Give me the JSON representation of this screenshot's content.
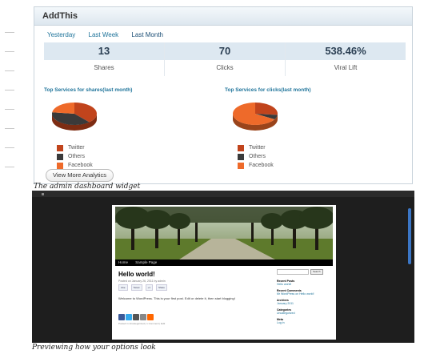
{
  "widget": {
    "title": "AddThis",
    "tabs": [
      "Yesterday",
      "Last Week",
      "Last Month"
    ],
    "stats": [
      {
        "value": "13",
        "label": "Shares"
      },
      {
        "value": "70",
        "label": "Clicks"
      },
      {
        "value": "538.46%",
        "label": "Viral Lift"
      }
    ],
    "shares_panel": {
      "title": "Top Services for shares(last month)",
      "legend": [
        "Twitter",
        "Others",
        "Facebook"
      ],
      "chart_data": {
        "type": "pie",
        "labels": [
          "Twitter",
          "Others",
          "Facebook"
        ],
        "values": [
          5,
          5,
          3
        ]
      }
    },
    "clicks_panel": {
      "title": "Top Services for clicks(last month)",
      "legend": [
        "Twitter",
        "Others",
        "Facebook"
      ],
      "chart_data": {
        "type": "pie",
        "labels": [
          "Twitter",
          "Others",
          "Facebook"
        ],
        "values": [
          4,
          1,
          10
        ]
      }
    },
    "colors": {
      "twitter": "#c1441c",
      "others": "#3a3a3a",
      "facebook": "#ee6a2a"
    },
    "button": "View More Analytics"
  },
  "caption1": "The admin dashboard widget",
  "preview": {
    "nav": [
      "Home",
      "Sample Page"
    ],
    "post_title": "Hello world!",
    "meta": "Posted on January 26, 2011 by admin",
    "share_buttons": [
      "Like",
      "Tweet",
      "+1",
      "Share"
    ],
    "body": "Welcome to WordPress. This is your first post. Edit or delete it, then start blogging!",
    "footer": "Posted in Uncategorized | 1 Comment | Edit",
    "search_button": "Search",
    "sidebar": [
      {
        "heading": "Recent Posts",
        "item": "Hello world!"
      },
      {
        "heading": "Recent Comments",
        "item": "Mr WordPress on Hello world!"
      },
      {
        "heading": "Archives",
        "item": "January 2011"
      },
      {
        "heading": "Categories",
        "item": "Uncategorized"
      },
      {
        "heading": "Meta",
        "item": "Log in"
      }
    ]
  },
  "caption2": "Previewing how your options look"
}
